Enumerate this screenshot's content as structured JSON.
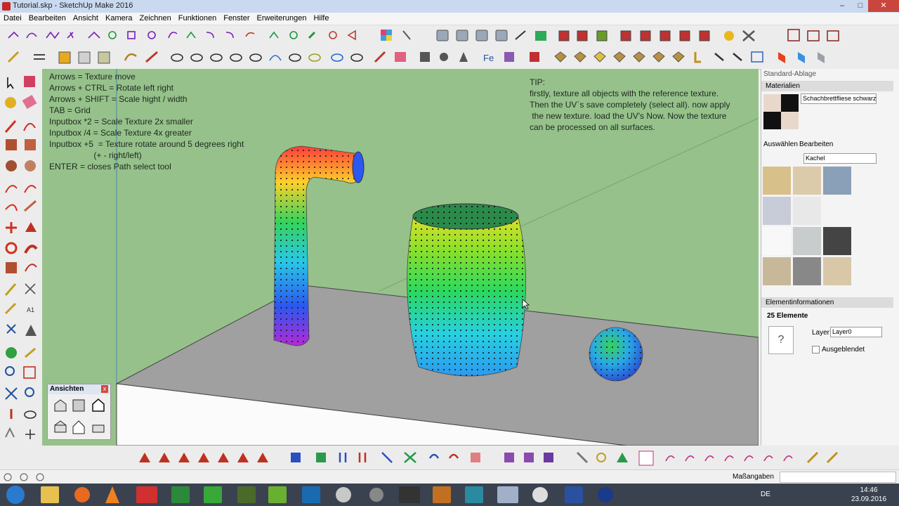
{
  "window": {
    "title": "Tutorial.skp - SketchUp Make 2016",
    "minimize": "–",
    "maximize": "□",
    "close": "✕"
  },
  "menu": [
    "Datei",
    "Bearbeiten",
    "Ansicht",
    "Kamera",
    "Zeichnen",
    "Funktionen",
    "Fenster",
    "Erweiterungen",
    "Hilfe"
  ],
  "instructions": {
    "lines": [
      "Arrows = Texture move",
      "Arrows + CTRL = Rotate left right",
      "Arrows + SHIFT = Scale hight / width",
      "TAB = Grid",
      "Inputbox *2 = Scale Texture 2x smaller",
      "Inputbox /4 = Scale Texture 4x greater",
      "Inputbox +5  = Texture rotate around 5 degrees right",
      "                   (+ - right/left)",
      "ENTER = closes Path select tool"
    ]
  },
  "tip": {
    "lines": [
      "TIP:",
      "firstly, texture all objects with the reference texture.",
      "Then the UV`s save completely (select all). now apply",
      " the new texture. load the UV's Now. Now the texture",
      "can be processed on all surfaces."
    ]
  },
  "views_panel": {
    "title": "Ansichten",
    "close": "x"
  },
  "right_panel": {
    "tray_title": "Standard-Ablage",
    "materials": {
      "header": "Materialien",
      "current_name": "Schachbrettfliese schwarz",
      "tab_select": "Auswählen",
      "tab_edit": "Bearbeiten",
      "library": "Kachel"
    },
    "entity_info": {
      "header": "Elementinformationen",
      "count": "25 Elemente",
      "layer_label": "Layer:",
      "layer_value": "Layer0",
      "hidden_label": "Ausgeblendet",
      "unknown_mark": "?"
    }
  },
  "status": {
    "measure_label": "Maßangaben",
    "measure_value": ""
  },
  "taskbar": {
    "language": "DE",
    "time": "14:46",
    "date": "23.09.2016"
  },
  "colors": {
    "viewport_bg": "#96c18b",
    "ground": "#9a9a9a",
    "taskbar": "#3a4250"
  }
}
